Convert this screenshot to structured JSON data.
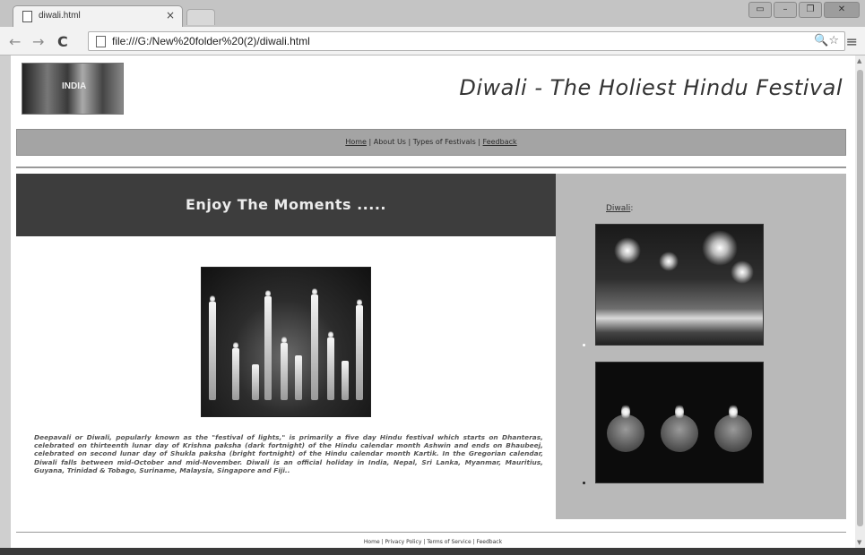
{
  "browser": {
    "tab_title": "diwali.html",
    "tab_close": "×",
    "url": "file:///G:/New%20folder%20(2)/diwali.html",
    "nav": {
      "back": "←",
      "forward": "→",
      "reload": "C"
    },
    "url_tools": "🔍☆",
    "menu": "≡",
    "window_controls": [
      "▭",
      "–",
      "❐",
      "✕"
    ]
  },
  "site": {
    "logo_text": "INDIA",
    "title": "Diwali - The Holiest Hindu Festival",
    "nav": {
      "home": "Home",
      "about": "About Us",
      "types": "Types of Festivals",
      "feedback": "Feedback",
      "separator": "|"
    },
    "banner": "Enjoy The Moments .....",
    "description": "Deepavali or Diwali, popularly known as the \"festival of lights,\" is primarily a five day Hindu festival which starts on Dhanteras, celebrated on thirteenth lunar day of Krishna paksha (dark fortnight) of the Hindu calendar month Ashwin and ends on Bhaubeej, celebrated on second lunar day of Shukla paksha (bright fortnight) of the Hindu calendar month Kartik. In the Gregorian calendar, Diwali falls between mid-October and mid-November. Diwali is an official holiday in India, Nepal, Sri Lanka, Myanmar, Mauritius, Guyana, Trinidad & Tobago, Suriname, Malaysia, Singapore and Fiji..",
    "sidebar_heading": "Diwali",
    "sidebar_heading_suffix": ":",
    "footer": "Home | Privacy Policy | Terms of Service | Feedback"
  }
}
